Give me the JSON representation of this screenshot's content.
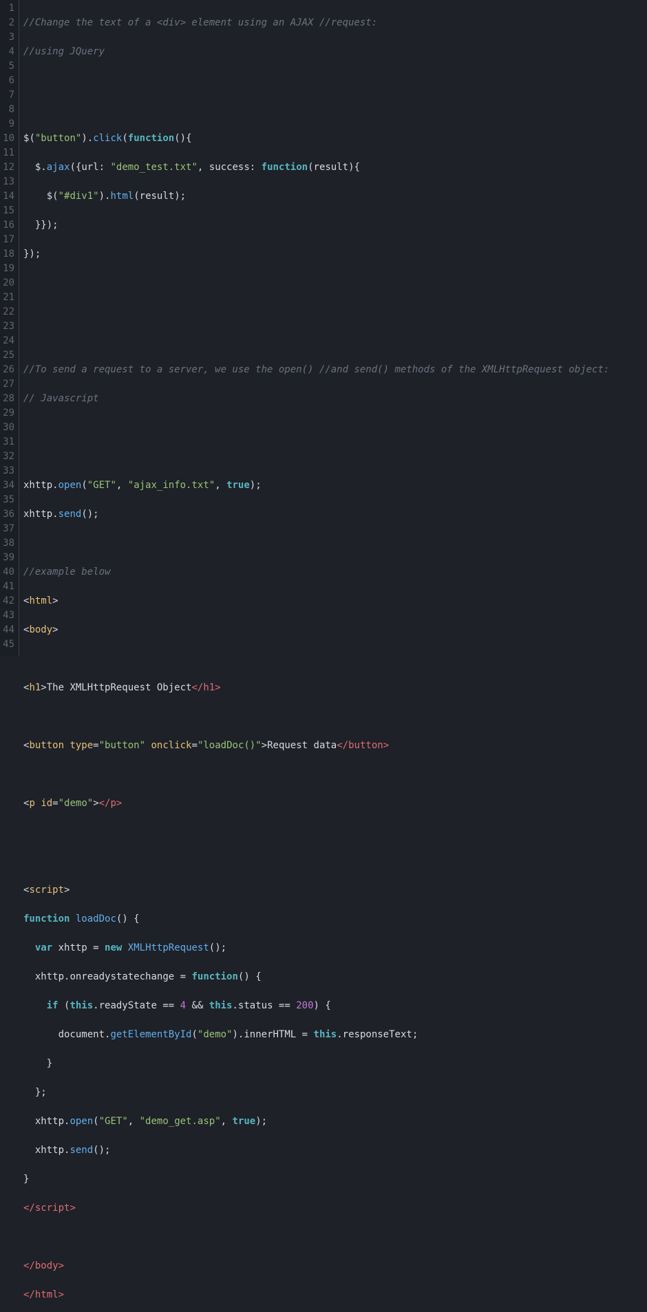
{
  "editor": {
    "lineCount": 45,
    "lineNumbers": [
      "1",
      "2",
      "3",
      "4",
      "5",
      "6",
      "7",
      "8",
      "9",
      "10",
      "11",
      "12",
      "13",
      "14",
      "15",
      "16",
      "17",
      "18",
      "19",
      "20",
      "21",
      "22",
      "23",
      "24",
      "25",
      "26",
      "27",
      "28",
      "29",
      "30",
      "31",
      "32",
      "33",
      "34",
      "35",
      "36",
      "37",
      "38",
      "39",
      "40",
      "41",
      "42",
      "43",
      "44",
      "45"
    ]
  },
  "code": {
    "l1_comment": "//Change the text of a <div> element using an AJAX //request:",
    "l2_comment": "//using JQuery",
    "l5": {
      "dollar": "$",
      "open": "(",
      "str": "\"button\"",
      "close": ")",
      "dot": ".",
      "click": "click",
      "open2": "(",
      "func": "function",
      "parens": "(){",
      "tail": ""
    },
    "l6": {
      "indent": "  ",
      "dollar": "$",
      "dot": ".",
      "ajax": "ajax",
      "open": "({",
      "url": "url",
      "colon": ": ",
      "str": "\"demo_test.txt\"",
      "comma": ", ",
      "success": "success",
      "colon2": ": ",
      "func": "function",
      "open2": "(",
      "result": "result",
      "close2": "){"
    },
    "l7": {
      "indent": "    ",
      "dollar": "$",
      "open": "(",
      "str": "\"#div1\"",
      "close": ")",
      "dot": ".",
      "html": "html",
      "open2": "(",
      "result": "result",
      "close2": ");"
    },
    "l8": {
      "indent": "  ",
      "text": "}});"
    },
    "l9": {
      "text": "});"
    },
    "l13_comment": "//To send a request to a server, we use the open() //and send() methods of the XMLHttpRequest object:",
    "l14_comment": "// Javascript",
    "l17": {
      "xhttp": "xhttp",
      "dot": ".",
      "open": "open",
      "lp": "(",
      "s1": "\"GET\"",
      "c1": ", ",
      "s2": "\"ajax_info.txt\"",
      "c2": ", ",
      "true": "true",
      "rp": ");"
    },
    "l18": {
      "xhttp": "xhttp",
      "dot": ".",
      "send": "send",
      "parens": "();"
    },
    "l20_comment": "//example below",
    "l21": {
      "open": "<",
      "tag": "html",
      "close": ">"
    },
    "l22": {
      "open": "<",
      "tag": "body",
      "close": ">"
    },
    "l24": {
      "open": "<",
      "tag": "h1",
      "close": ">",
      "text": "The XMLHttpRequest Object",
      "copen": "</",
      "ctag": "h1",
      "cclose": ">"
    },
    "l26": {
      "open": "<",
      "tag": "button",
      "sp": " ",
      "attr1": "type",
      "eq": "=",
      "val1": "\"button\"",
      "sp2": " ",
      "attr2": "onclick",
      "eq2": "=",
      "val2": "\"loadDoc()\"",
      "close": ">",
      "text": "Request data",
      "copen": "</",
      "ctag": "button",
      "cclose": ">"
    },
    "l28": {
      "open": "<",
      "tag": "p",
      "sp": " ",
      "attr": "id",
      "eq": "=",
      "val": "\"demo\"",
      "close": ">",
      "copen": "</",
      "ctag": "p",
      "cclose": ">"
    },
    "l31": {
      "open": "<",
      "tag": "script",
      "close": ">"
    },
    "l32": {
      "func": "function",
      "sp": " ",
      "name": "loadDoc",
      "parens": "() {"
    },
    "l33": {
      "indent": "  ",
      "var": "var",
      "sp": " ",
      "xhttp": "xhttp",
      "eq": " = ",
      "new": "new",
      "sp2": " ",
      "ctor": "XMLHttpRequest",
      "parens": "();"
    },
    "l34": {
      "indent": "  ",
      "xhttp": "xhttp",
      "dot": ".",
      "prop": "onreadystatechange",
      "eq": " = ",
      "func": "function",
      "parens": "() {"
    },
    "l35": {
      "indent": "    ",
      "if": "if",
      "sp": " (",
      "this1": "this",
      "dot1": ".",
      "rs": "readyState",
      "eq1": " == ",
      "n1": "4",
      "and": " && ",
      "this2": "this",
      "dot2": ".",
      "st": "status",
      "eq2": " == ",
      "n2": "200",
      "close": ") {"
    },
    "l36": {
      "indent": "      ",
      "doc": "document",
      "dot": ".",
      "gebi": "getElementById",
      "lp": "(",
      "s": "\"demo\"",
      "rp": ")",
      "dot2": ".",
      "inner": "innerHTML",
      "eq": " = ",
      "this": "this",
      "dot3": ".",
      "rt": "responseText",
      "semi": ";"
    },
    "l37": {
      "indent": "    ",
      "text": "}"
    },
    "l38": {
      "indent": "  ",
      "text": "};"
    },
    "l39": {
      "indent": "  ",
      "xhttp": "xhttp",
      "dot": ".",
      "open": "open",
      "lp": "(",
      "s1": "\"GET\"",
      "c1": ", ",
      "s2": "\"demo_get.asp\"",
      "c2": ", ",
      "true": "true",
      "rp": ");"
    },
    "l40": {
      "indent": "  ",
      "xhttp": "xhttp",
      "dot": ".",
      "send": "send",
      "parens": "();"
    },
    "l41": {
      "text": "}"
    },
    "l42": {
      "open": "</",
      "tag": "script",
      "close": ">"
    },
    "l44": {
      "open": "</",
      "tag": "body",
      "close": ">"
    },
    "l45": {
      "open": "</",
      "tag": "html",
      "close": ">"
    }
  }
}
